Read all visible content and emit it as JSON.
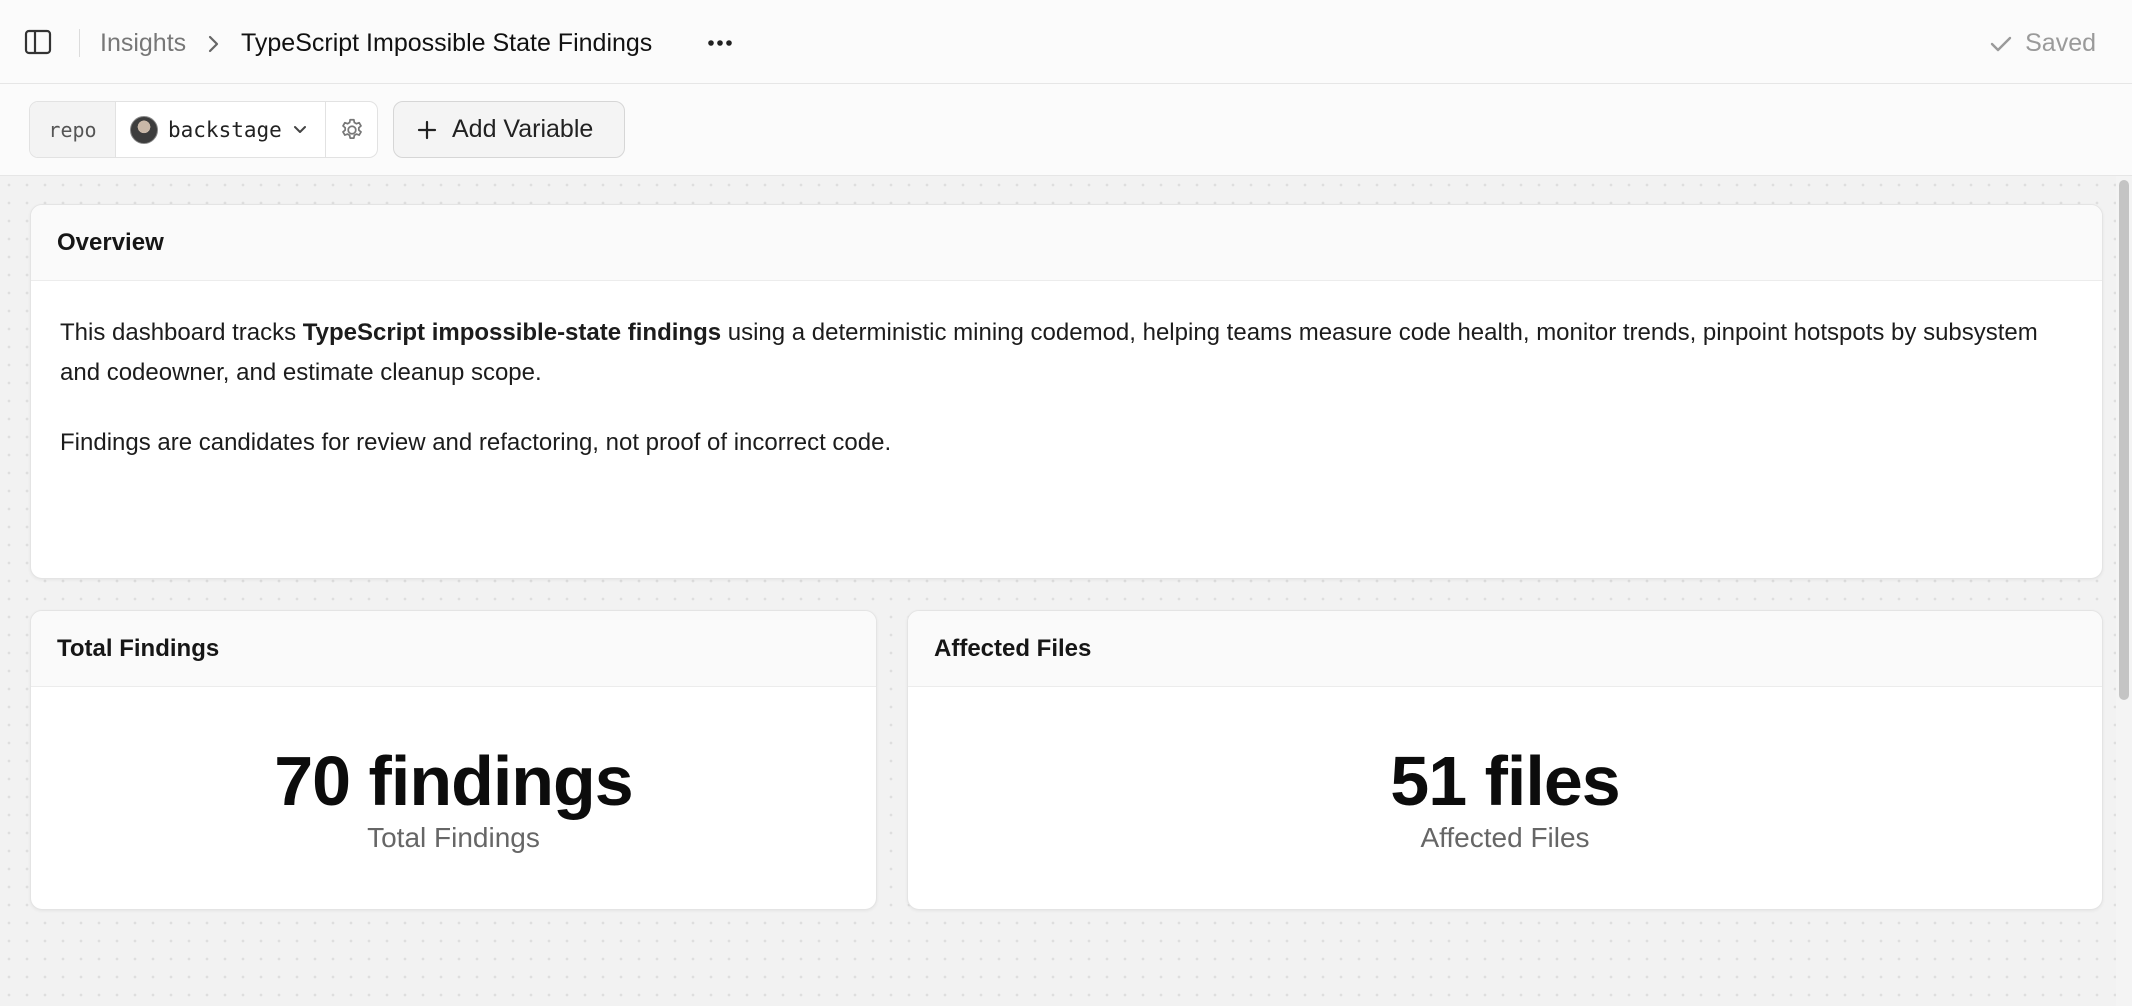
{
  "header": {
    "breadcrumb_parent": "Insights",
    "title": "TypeScript Impossible State Findings",
    "saved_label": "Saved",
    "icons": [
      "sidebar-toggle-icon",
      "chevron-right-icon",
      "more-horizontal-icon",
      "check-icon"
    ]
  },
  "variables": {
    "items": [
      {
        "key": "repo",
        "value": "backstage"
      }
    ],
    "add_label": "Add Variable"
  },
  "overview": {
    "title": "Overview",
    "p1_prefix": "This dashboard tracks ",
    "p1_bold": "TypeScript impossible-state findings",
    "p1_suffix": " using a deterministic mining codemod, helping teams measure code health, monitor trends, pinpoint hotspots by subsystem and codeowner, and estimate cleanup scope.",
    "p2": "Findings are candidates for review and refactoring, not proof of incorrect code."
  },
  "metrics": [
    {
      "title": "Total Findings",
      "value": "70 findings",
      "label": "Total Findings"
    },
    {
      "title": "Affected Files",
      "value": "51 files",
      "label": "Affected Files"
    }
  ],
  "colors": {
    "canvas_bg": "#f2f2f2",
    "card_bg": "#ffffff",
    "muted_text": "#777777",
    "saved_text": "#9a9a9a"
  }
}
